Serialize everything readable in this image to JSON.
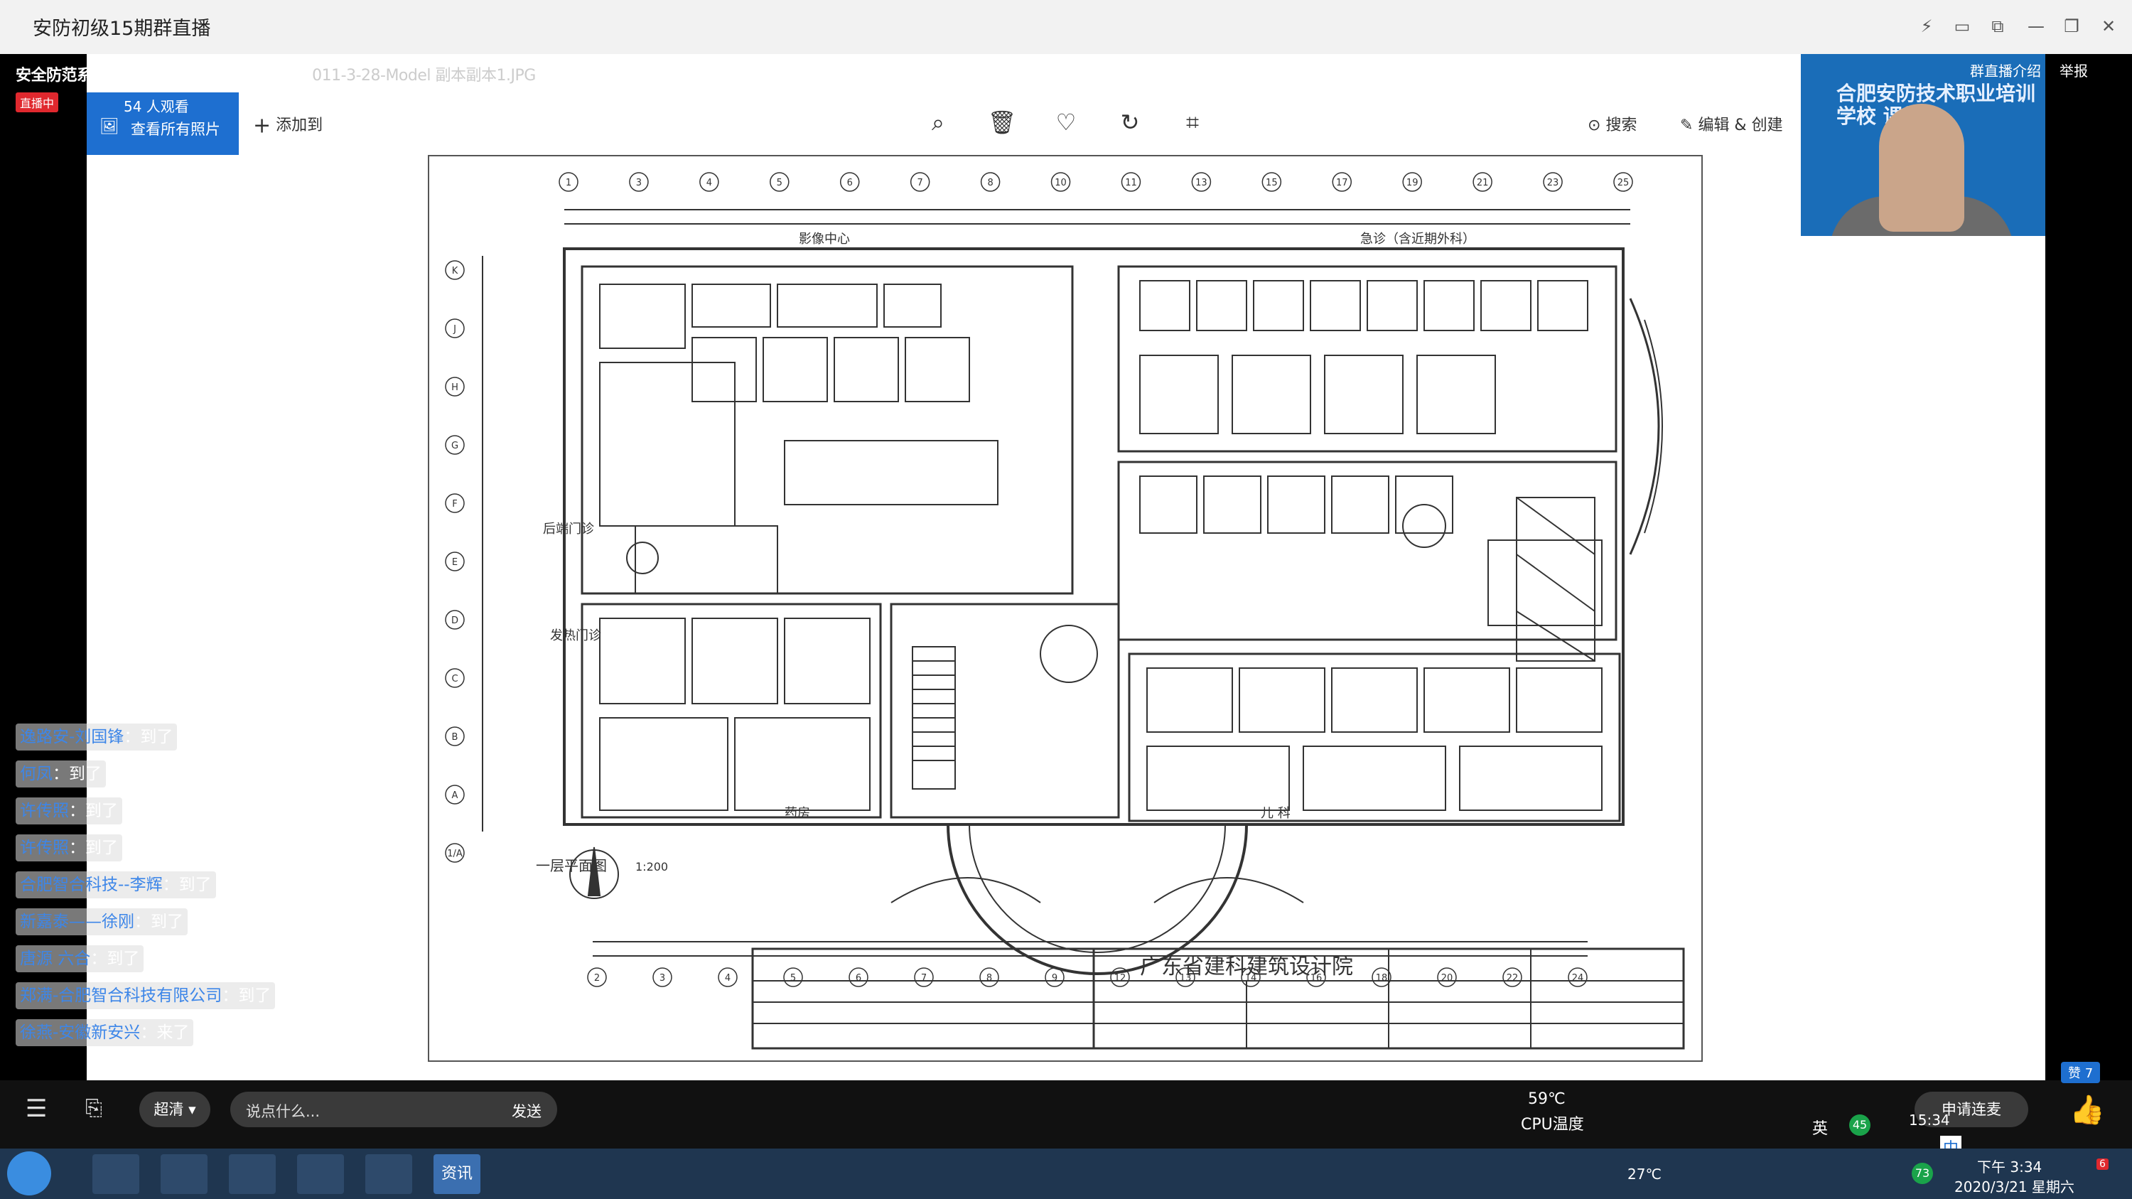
{
  "window": {
    "title": "安防初级15期群直播",
    "controls": [
      "⚡",
      "▭",
      "⧉",
      "—",
      "❐",
      "✕"
    ]
  },
  "live": {
    "heading": "安全防范系统安装维护员（基础-初级）课程",
    "file_name": "011-3-28-Model 副本副本1.JPG",
    "badge": "直播中",
    "viewers": "54 人观看",
    "view_all": "查看所有照片",
    "add_to": "添加到",
    "search": "搜索",
    "edit_create": "编辑 & 创建",
    "intro": "群直播介绍",
    "report": "举报",
    "cam_brand": "合肥安防技术职业培训学校 课堂"
  },
  "plan": {
    "title": "一层平面图",
    "scale": "1:200",
    "labels": {
      "imaging": "影像中心",
      "emergency": "急诊（含近期外科）",
      "pharmacy": "药房",
      "pediatrics": "儿  科",
      "clinic": "后端门诊",
      "fever": "发热门诊",
      "institute": "广东省建科建筑设计院"
    },
    "grid_top": [
      "1",
      "3",
      "4",
      "5",
      "6",
      "7",
      "8",
      "10",
      "11",
      "13",
      "15",
      "17",
      "19",
      "21",
      "23",
      "25"
    ],
    "grid_bottom": [
      "2",
      "3",
      "4",
      "5",
      "6",
      "7",
      "8",
      "9",
      "12",
      "13",
      "14",
      "16",
      "18",
      "20",
      "22",
      "24"
    ],
    "grid_left": [
      "K",
      "J",
      "H",
      "G",
      "F",
      "E",
      "D",
      "C",
      "B",
      "A",
      "1/A"
    ]
  },
  "chat": [
    {
      "name": "逸路安-刘国锋",
      "msg": "：到了"
    },
    {
      "name": "何凤",
      "msg": "：到了"
    },
    {
      "name": "许传照",
      "msg": "：到了"
    },
    {
      "name": "许传照",
      "msg": "：到了"
    },
    {
      "name": "合肥智合科技--李辉",
      "msg": "：到了"
    },
    {
      "name": "新嘉泰——徐刚",
      "msg": "：到了"
    },
    {
      "name": "唐源 六合",
      "msg": "：到了"
    },
    {
      "name": "郑满-合肥智合科技有限公司",
      "msg": "：到了"
    },
    {
      "name": "徐燕-安徽新安兴",
      "msg": "：来了"
    }
  ],
  "bottom": {
    "quality": "超清",
    "say_placeholder": "说点什么...",
    "send": "发送",
    "apply_mic": "申请连麦",
    "likes": "赞 7",
    "cpu_temp": "59℃",
    "cpu_label": "CPU温度",
    "time_small": "15:34",
    "ime": "中",
    "lang": "英",
    "battery": "45"
  },
  "taskbar": {
    "app_label": "资讯",
    "weather": "27℃",
    "clock_time": "下午 3:34",
    "clock_date": "2020/3/21 星期六",
    "badge": "73",
    "notif": "6"
  },
  "colors": {
    "live_red": "#e0282e",
    "button_blue": "#1e6fd0",
    "chat_name": "#3d86e8",
    "taskbar": "#1f3650"
  }
}
